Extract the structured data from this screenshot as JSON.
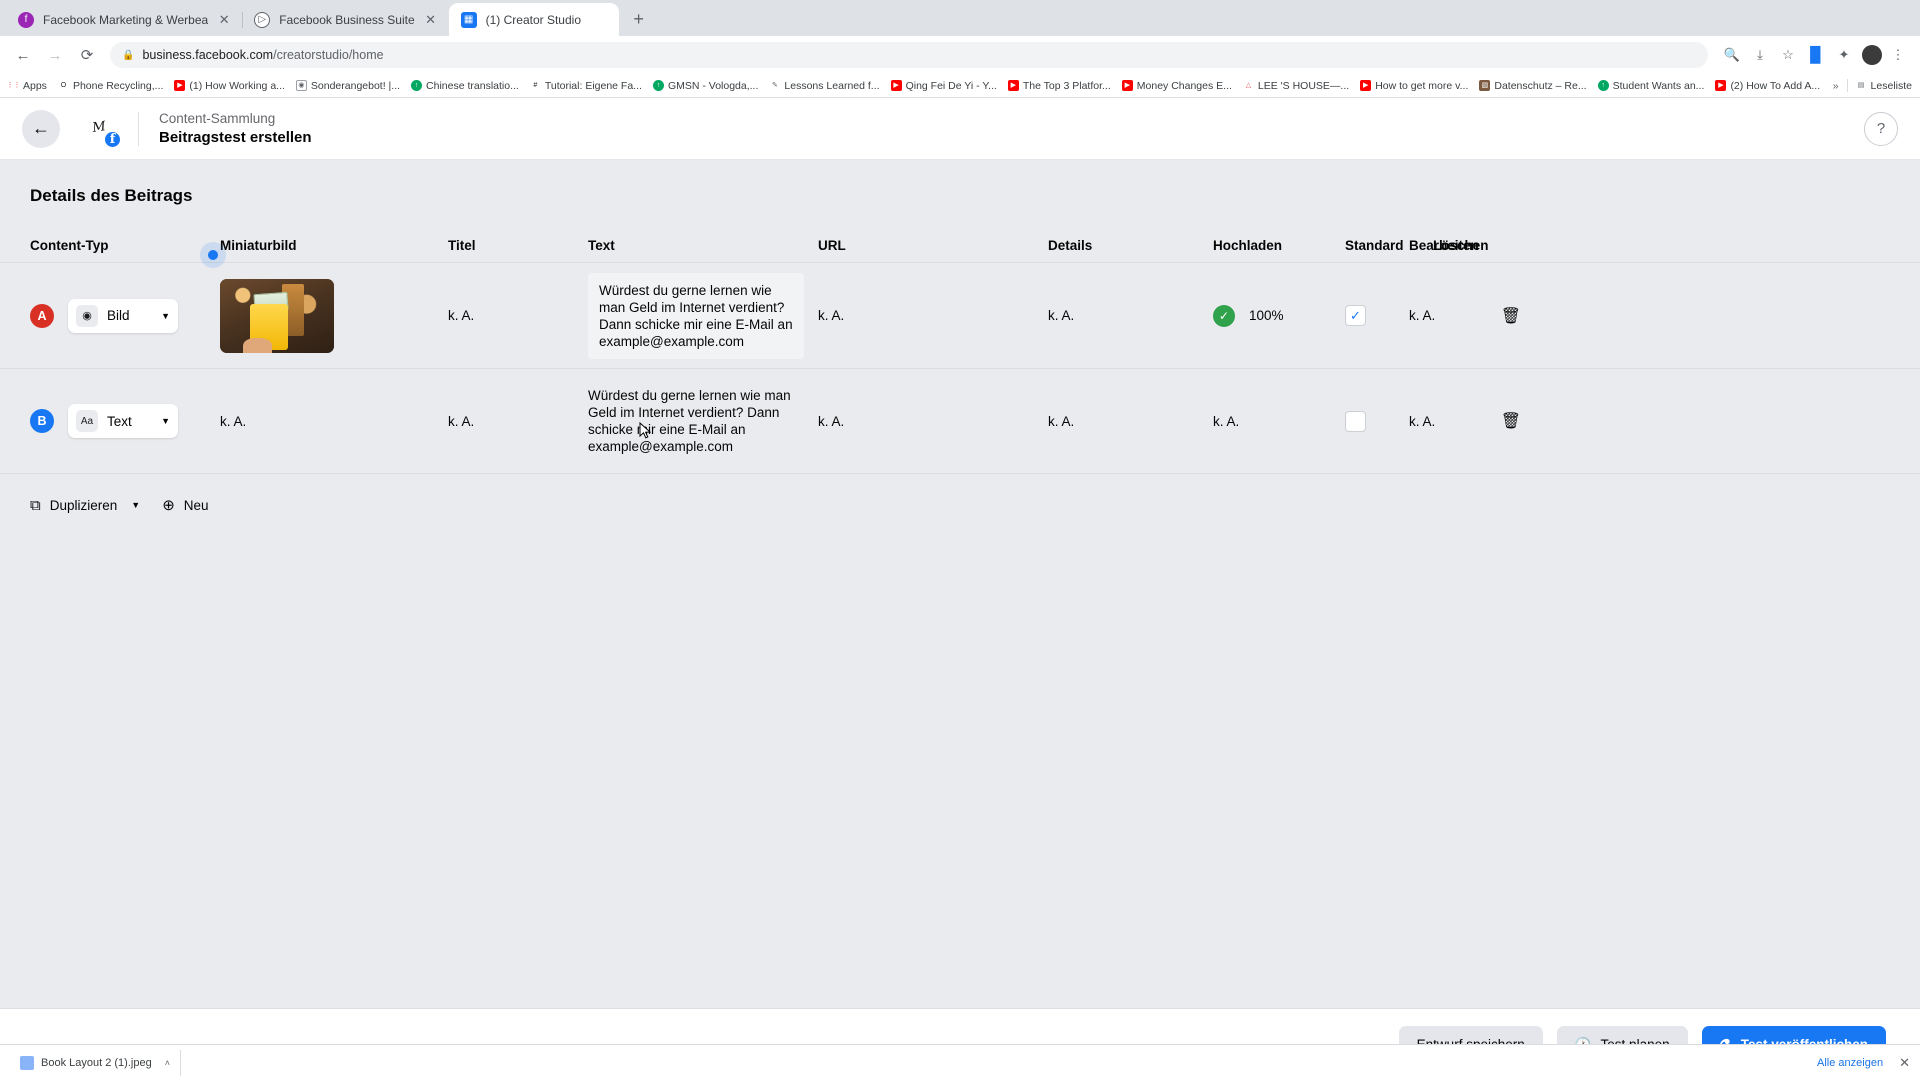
{
  "browser": {
    "tabs": [
      {
        "title": "Facebook Marketing & Werbea",
        "favicon": "facebook-round-icon",
        "active": false,
        "closable": true
      },
      {
        "title": "Facebook Business Suite",
        "favicon": "business-suite-icon",
        "active": false,
        "closable": true
      },
      {
        "title": "(1) Creator Studio",
        "favicon": "creator-studio-icon",
        "active": true,
        "closable": false
      }
    ],
    "new_tab_label": "+",
    "nav": {
      "back": "←",
      "forward": "→",
      "reload": "⟳"
    },
    "omnibox": {
      "lock": "🔒",
      "host": "business.facebook.com",
      "path": "/creatorstudio/home"
    },
    "toolbar_icons": [
      "zoom-search-icon",
      "share-icon",
      "bookmark-star-icon",
      "facebook-extension-icon",
      "extensions-icon",
      "profile-avatar",
      "chrome-menu-icon"
    ],
    "bookmarks": [
      {
        "label": "Apps",
        "icon": "apps-grid-icon",
        "color": "#ea4335"
      },
      {
        "label": "Phone Recycling,...",
        "icon": "o2-icon",
        "color": "#ffffff"
      },
      {
        "label": "(1) How Working a...",
        "icon": "youtube-icon",
        "color": "#ff0000"
      },
      {
        "label": "Sonderangebot! |...",
        "icon": "circle-icon",
        "color": "#5f6368"
      },
      {
        "label": "Chinese translatio...",
        "icon": "green-circle-icon",
        "color": "#00a862"
      },
      {
        "label": "Tutorial: Eigene Fa...",
        "icon": "hash-icon",
        "color": "#1c1e21"
      },
      {
        "label": "GMSN - Vologda,...",
        "icon": "green-circle-icon",
        "color": "#00a862"
      },
      {
        "label": "Lessons Learned f...",
        "icon": "pencil-icon",
        "color": "#5f6368"
      },
      {
        "label": "Qing Fei De Yi - Y...",
        "icon": "youtube-icon",
        "color": "#ff0000"
      },
      {
        "label": "The Top 3 Platfor...",
        "icon": "youtube-icon",
        "color": "#ff0000"
      },
      {
        "label": "Money Changes E...",
        "icon": "youtube-icon",
        "color": "#ff0000"
      },
      {
        "label": "LEE 'S HOUSE—...",
        "icon": "triangle-icon",
        "color": "#e94f64"
      },
      {
        "label": "How to get more v...",
        "icon": "youtube-icon",
        "color": "#ff0000"
      },
      {
        "label": "Datenschutz – Re...",
        "icon": "image-icon",
        "color": "#7b5a3f"
      },
      {
        "label": "Student Wants an...",
        "icon": "green-circle-icon",
        "color": "#00a862"
      },
      {
        "label": "(2) How To Add A...",
        "icon": "youtube-icon",
        "color": "#ff0000"
      }
    ],
    "bookmarks_overflow": "»",
    "reading_list": "Leseliste"
  },
  "app_header": {
    "back_icon": "←",
    "brand_initials": "M",
    "brand_badge": "f",
    "breadcrumb": "Content-Sammlung",
    "title": "Beitragstest erstellen",
    "help_icon": "?"
  },
  "page": {
    "section_title": "Details des Beitrags",
    "columns": [
      {
        "key": "type",
        "label": "Content-Typ"
      },
      {
        "key": "thumb",
        "label": "Miniaturbild"
      },
      {
        "key": "title",
        "label": "Titel"
      },
      {
        "key": "text",
        "label": "Text"
      },
      {
        "key": "url",
        "label": "URL"
      },
      {
        "key": "details",
        "label": "Details"
      },
      {
        "key": "upload",
        "label": "Hochladen"
      },
      {
        "key": "standard",
        "label": "Standard"
      },
      {
        "key": "edit",
        "label": "Bearbeiten"
      },
      {
        "key": "delete",
        "label": "Löschen"
      }
    ],
    "rows": [
      {
        "badge": "A",
        "badge_color": "#d93025",
        "type_value": "Bild",
        "type_icon": "image-icon",
        "has_thumbnail": true,
        "thumbnail_alt": "Hand hält gelben Umschlag mit Geldscheinen",
        "title": "k. A.",
        "text": "Würdest du gerne lernen wie man Geld im Internet verdient? Dann schicke mir eine E-Mail an example@example.com",
        "text_highlighted": true,
        "url": "k. A.",
        "details": "k. A.",
        "upload_status": "complete",
        "upload_percent": "100%",
        "standard_checked": true,
        "edit": "k. A.",
        "delete_icon": "trash-icon"
      },
      {
        "badge": "B",
        "badge_color": "#1877f2",
        "type_value": "Text",
        "type_icon": "text-aa-icon",
        "has_thumbnail": false,
        "thumbnail_placeholder": "k. A.",
        "title": "k. A.",
        "text": "Würdest du gerne lernen wie man Geld im Internet verdient? Dann schicke mir eine E-Mail an example@example.com",
        "text_highlighted": false,
        "url": "k. A.",
        "details": "k. A.",
        "upload_status": "none",
        "upload_percent": "k. A.",
        "standard_checked": false,
        "edit": "k. A.",
        "delete_icon": "trash-icon"
      }
    ],
    "row_actions": {
      "duplicate_label": "Duplizieren",
      "duplicate_icon": "copy-icon",
      "new_label": "Neu",
      "new_icon": "plus-circle-icon"
    }
  },
  "footer": {
    "save_draft_label": "Entwurf speichern",
    "schedule_label": "Test planen",
    "schedule_icon": "clock-icon",
    "publish_label": "Test veröffentlichen",
    "publish_icon": "flask-icon"
  },
  "downloads": {
    "file_name": "Book Layout 2 (1).jpeg",
    "file_icon": "jpeg-file-icon",
    "caret": "˄",
    "show_all_label": "Alle anzeigen",
    "close_label": "✕"
  }
}
